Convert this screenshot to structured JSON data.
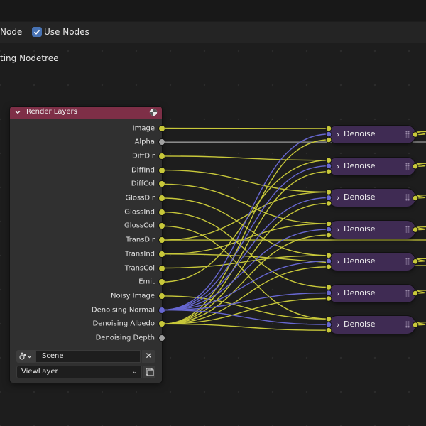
{
  "header": {
    "node_label": "Node",
    "use_nodes_label": "Use Nodes",
    "use_nodes_checked": true
  },
  "tree_label": "ting Nodetree",
  "colors": {
    "yellow_socket": "#c8c83a",
    "blue_socket": "#6767d0",
    "gray_socket": "#a1a1a1",
    "render_layers_header": "#7e2f47",
    "denoise_body": "#3f2b53"
  },
  "render_layers": {
    "title": "Render Layers",
    "outputs": [
      {
        "label": "Image",
        "socket": "yellow"
      },
      {
        "label": "Alpha",
        "socket": "gray"
      },
      {
        "label": "DiffDir",
        "socket": "yellow"
      },
      {
        "label": "DiffInd",
        "socket": "yellow"
      },
      {
        "label": "DiffCol",
        "socket": "yellow"
      },
      {
        "label": "GlossDir",
        "socket": "yellow"
      },
      {
        "label": "GlossInd",
        "socket": "yellow"
      },
      {
        "label": "GlossCol",
        "socket": "yellow"
      },
      {
        "label": "TransDir",
        "socket": "yellow"
      },
      {
        "label": "TransInd",
        "socket": "yellow"
      },
      {
        "label": "TransCol",
        "socket": "yellow"
      },
      {
        "label": "Emit",
        "socket": "yellow"
      },
      {
        "label": "Noisy Image",
        "socket": "yellow"
      },
      {
        "label": "Denoising Normal",
        "socket": "blue"
      },
      {
        "label": "Denoising Albedo",
        "socket": "yellow"
      },
      {
        "label": "Denoising Depth",
        "socket": "gray"
      }
    ],
    "scene": "Scene",
    "view_layer": "ViewLayer"
  },
  "denoise_nodes": [
    {
      "label": "Denoise"
    },
    {
      "label": "Denoise"
    },
    {
      "label": "Denoise"
    },
    {
      "label": "Denoise"
    },
    {
      "label": "Denoise"
    },
    {
      "label": "Denoise"
    },
    {
      "label": "Denoise"
    }
  ]
}
